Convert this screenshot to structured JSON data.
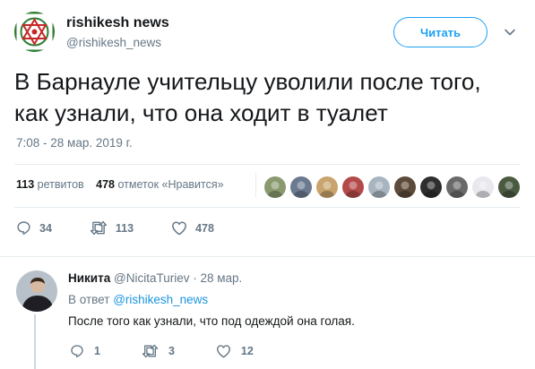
{
  "tweet": {
    "author_name": "rishikesh news",
    "author_handle": "@rishikesh_news",
    "follow_label": "Читать",
    "text_line1": "В Барнауле учительцу уволили после того,",
    "text_line2": "как узнали, что она ходит в туалет",
    "timestamp": "7:08 - 28 мар. 2019 г.",
    "retweets_count": "113",
    "retweets_label": "ретвитов",
    "likes_count": "478",
    "likes_label": "отметок «Нравится»",
    "actions": {
      "replies": "34",
      "retweets": "113",
      "likes": "478"
    },
    "liker_colors": [
      "#8a9a6e",
      "#6b7a8f",
      "#c9a46e",
      "#b34a4a",
      "#a8b4c0",
      "#5c4a3a",
      "#2e2e2e",
      "#6a6a6a",
      "#e8e8ee",
      "#4a5a40"
    ]
  },
  "reply": {
    "author_name": "Никита",
    "author_handle": "@NicitaTuriev",
    "date": "· 28 мар.",
    "reply_to_prefix": "В ответ",
    "reply_to_handle": "@rishikesh_news",
    "text": "После того как узнали, что под одеждой она голая.",
    "actions": {
      "replies": "1",
      "retweets": "3",
      "likes": "12"
    }
  },
  "colors": {
    "accent": "#1da1f2",
    "link": "#1b95e0",
    "secondary_text": "#657786",
    "primary_text": "#14171a",
    "divider": "#e6ecf0",
    "logo_green": "#2e7d32",
    "logo_red": "#c62828"
  }
}
